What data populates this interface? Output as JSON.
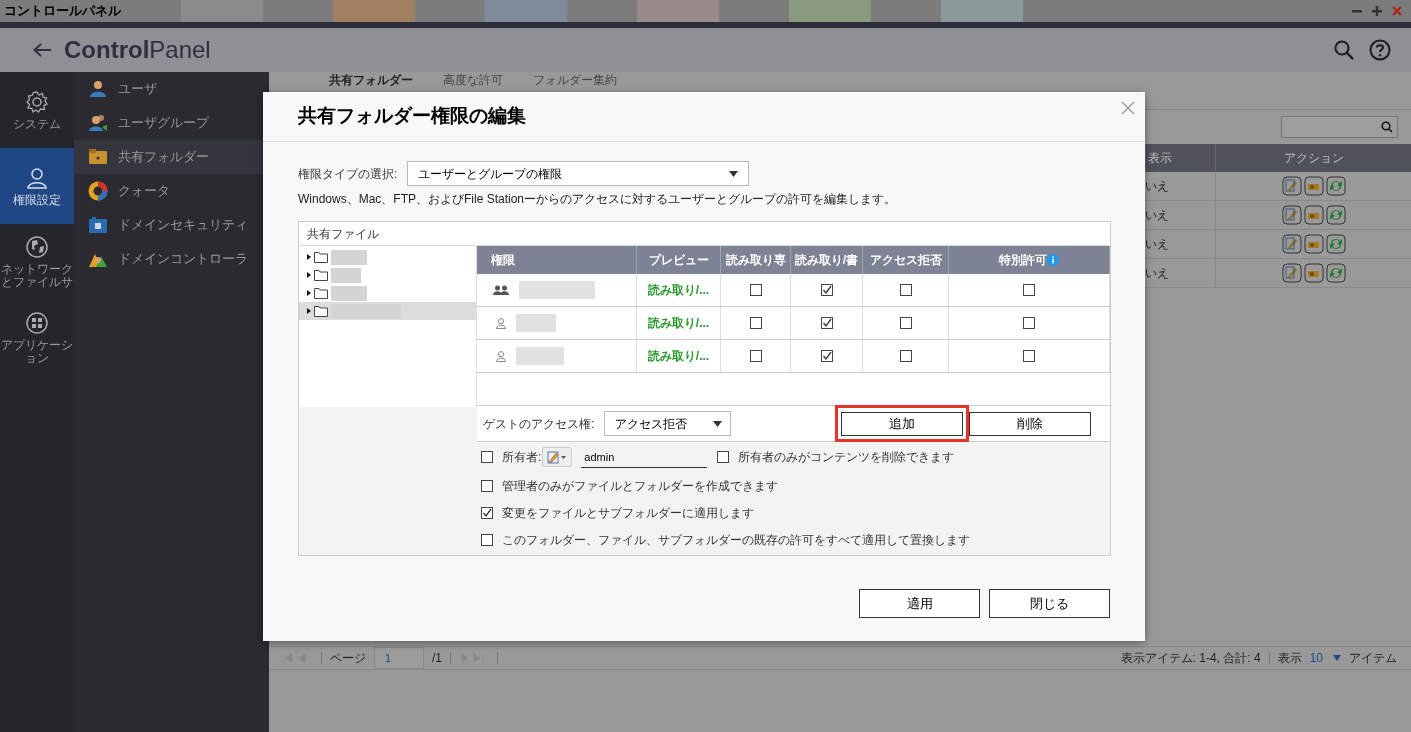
{
  "window": {
    "title": "コントロールパネル"
  },
  "header": {
    "title": "**Control**Panel"
  },
  "nav_rail": [
    {
      "label": "システム",
      "selected": false
    },
    {
      "label": "権限設定",
      "selected": true
    },
    {
      "label": "ネットワークとファイルサ",
      "selected": false
    },
    {
      "label": "アプリケーション",
      "selected": false
    }
  ],
  "submenu": [
    {
      "label": "ユーザ",
      "selected": false
    },
    {
      "label": "ユーザグループ",
      "selected": false
    },
    {
      "label": "共有フォルダー",
      "selected": true
    },
    {
      "label": "クォータ",
      "selected": false
    },
    {
      "label": "ドメインセキュリティ",
      "selected": false
    },
    {
      "label": "ドメインコントローラ",
      "selected": false
    }
  ],
  "background": {
    "tabs": [
      {
        "label": "共有フォルダー",
        "selected": true
      },
      {
        "label": "高度な許可",
        "selected": false
      },
      {
        "label": "フォルダー集約",
        "selected": false
      }
    ],
    "columns": [
      "表示",
      "アクション"
    ],
    "rows": [
      {
        "column_1": "いえ"
      },
      {
        "column_1": "いえ"
      },
      {
        "column_1": "いえ"
      },
      {
        "column_1": "いえ"
      }
    ],
    "pager": {
      "page_label": "ページ",
      "page": "1",
      "page_total": "/1",
      "summary": "表示アイテム: 1-4, 合計: 4",
      "display_label": "表示",
      "per_page": "10",
      "items_label": "アイテム"
    }
  },
  "dialog": {
    "title": "共有フォルダー権限の編集",
    "permission_type": {
      "label": "権限タイプの選択:",
      "value": "ユーザーとグループの権限"
    },
    "description": "Windows、Mac、FTP、およびFile Stationーからのアクセスに対するユーザーとグループの許可を編集します。",
    "tree": {
      "header": "共有ファイル",
      "folders": [
        {
          "selected": false
        },
        {
          "selected": false
        },
        {
          "selected": false
        },
        {
          "selected": true
        }
      ]
    },
    "columns": [
      "権限",
      "プレビュー",
      "読み取り専",
      "読み取り/書",
      "アクセス拒否",
      "特別許可"
    ],
    "rows": [
      {
        "kind": "group",
        "preview": "読み取り/...",
        "read_only": false,
        "read_write": true,
        "deny": false,
        "special": false
      },
      {
        "kind": "user",
        "preview": "読み取り/...",
        "read_only": false,
        "read_write": true,
        "deny": false,
        "special": false
      },
      {
        "kind": "user",
        "preview": "読み取り/...",
        "read_only": false,
        "read_write": true,
        "deny": false,
        "special": false
      }
    ],
    "guest": {
      "label": "ゲストのアクセス権:",
      "value": "アクセス拒否"
    },
    "add_button": {
      "label": "追加",
      "highlighted": true
    },
    "remove_button": {
      "label": "削除"
    },
    "owner": {
      "checked": false,
      "label": "所有者:",
      "value": "admin",
      "delete_only": {
        "checked": false,
        "label": "所有者のみがコンテンツを削除できます"
      }
    },
    "options": [
      {
        "label": "管理者のみがファイルとフォルダーを作成できます",
        "checked": false
      },
      {
        "label": "変更をファイルとサブフォルダーに適用します",
        "checked": true
      },
      {
        "label": "このフォルダー、ファイル、サブフォルダーの既存の許可をすべて適用して置換します",
        "checked": false
      }
    ],
    "buttons": [
      "適用",
      "閉じる"
    ]
  }
}
